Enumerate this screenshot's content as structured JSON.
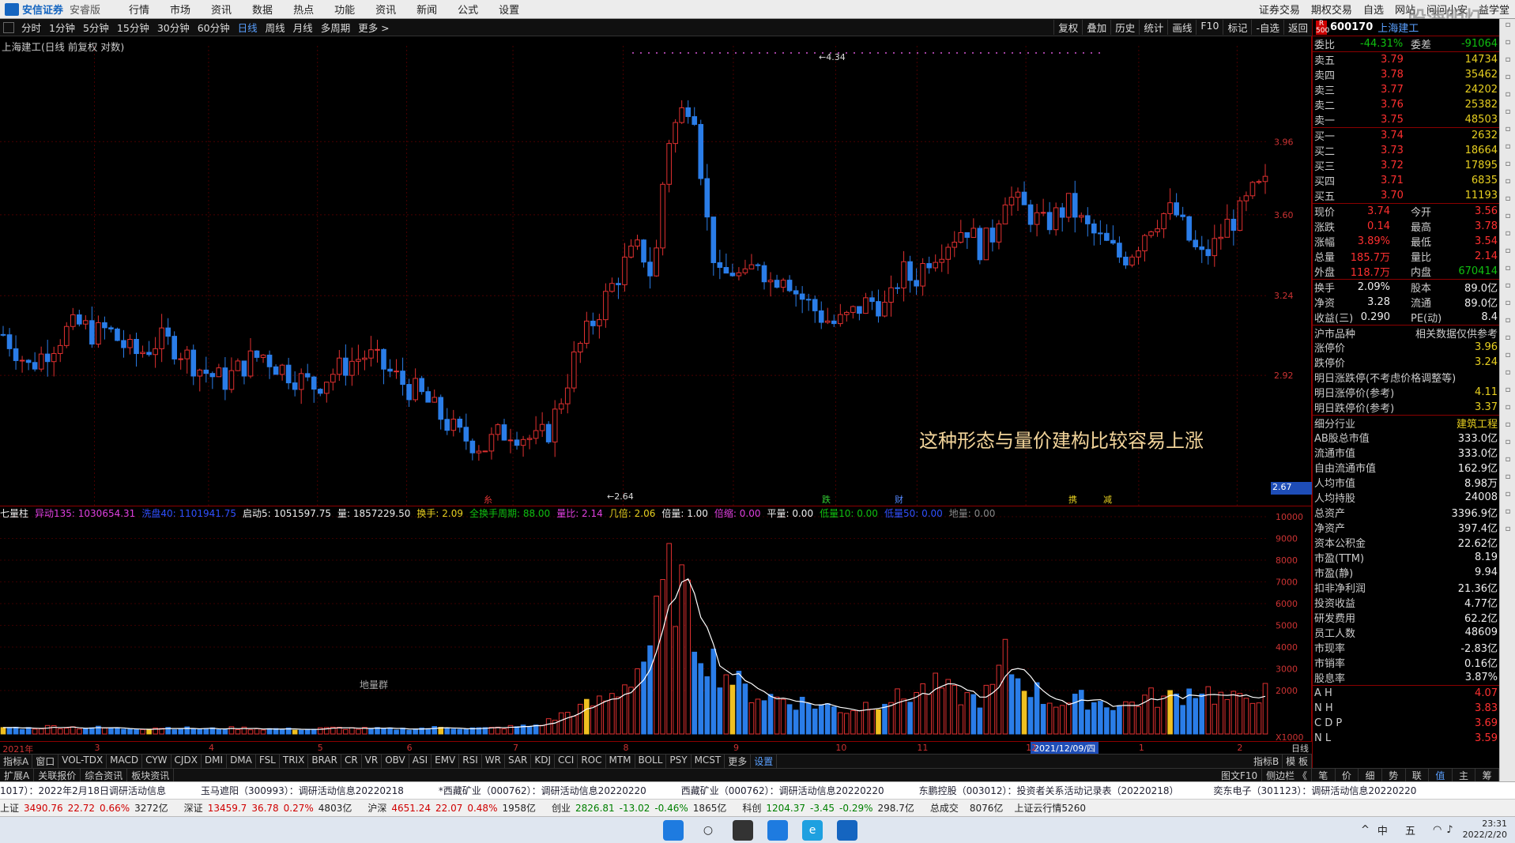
{
  "app": {
    "brand": "安信证券",
    "version": "安睿版",
    "watermark": "股海明灯"
  },
  "menu": [
    "行情",
    "市场",
    "资讯",
    "数据",
    "热点",
    "功能",
    "资讯",
    "新闻",
    "公式",
    "设置"
  ],
  "menu_right": [
    "证券交易",
    "期权交易",
    "自选",
    "网站",
    "问问小安",
    "益学堂"
  ],
  "periods": [
    "分时",
    "1分钟",
    "5分钟",
    "15分钟",
    "30分钟",
    "60分钟",
    "日线",
    "周线",
    "月线",
    "多周期",
    "更多 >"
  ],
  "active_period": "日线",
  "toolbar_right": [
    "复权",
    "叠加",
    "历史",
    "统计",
    "画线",
    "F10",
    "标记",
    "-自选",
    "返回"
  ],
  "chart_title": "上海建工(日线 前复权 对数)",
  "annotation": "这种形态与量价建构比较容易上涨",
  "price_labels": [
    "3.96",
    "3.60",
    "3.24",
    "2.92"
  ],
  "current_price_tag": "2.67",
  "high_label": "4.34",
  "low_label": "2.64",
  "event_marks": [
    "糸",
    "跌",
    "财",
    "携",
    "减"
  ],
  "vol_labels": [
    "10000",
    "9000",
    "8000",
    "7000",
    "6000",
    "5000",
    "4000",
    "3000",
    "2000",
    "X1000"
  ],
  "vol_note": "地量群",
  "vinfo": [
    {
      "t": "七量柱",
      "c": "#eee"
    },
    {
      "t": "异动135: 1030654.31",
      "c": "#e040e0"
    },
    {
      "t": "洗盘40: 1101941.75",
      "c": "#3050ff"
    },
    {
      "t": "启动5: 1051597.75",
      "c": "#eee"
    },
    {
      "t": "量: 1857229.50",
      "c": "#eee"
    },
    {
      "t": "换手: 2.09",
      "c": "#e8d020"
    },
    {
      "t": "全换手周期: 88.00",
      "c": "#10c010"
    },
    {
      "t": "量比: 2.14",
      "c": "#e040e0"
    },
    {
      "t": "几倍: 2.06",
      "c": "#e8d020"
    },
    {
      "t": "倍量: 1.00",
      "c": "#eee"
    },
    {
      "t": "倍缩: 0.00",
      "c": "#e040e0"
    },
    {
      "t": "平量: 0.00",
      "c": "#eee"
    },
    {
      "t": "低量10: 0.00",
      "c": "#10c010"
    },
    {
      "t": "低量50: 0.00",
      "c": "#3050ff"
    },
    {
      "t": "地量: 0.00",
      "c": "#888"
    }
  ],
  "xaxis": [
    {
      "t": "2021年",
      "p": 0.2
    },
    {
      "t": "3",
      "p": 7.2
    },
    {
      "t": "4",
      "p": 15.9
    },
    {
      "t": "5",
      "p": 24.2
    },
    {
      "t": "6",
      "p": 31.0
    },
    {
      "t": "7",
      "p": 39.1
    },
    {
      "t": "8",
      "p": 47.5
    },
    {
      "t": "9",
      "p": 55.9
    },
    {
      "t": "10",
      "p": 63.7
    },
    {
      "t": "11",
      "p": 69.9
    },
    {
      "t": "12",
      "p": 78.2
    },
    {
      "t": "1",
      "p": 86.8
    },
    {
      "t": "2",
      "p": 94.3
    }
  ],
  "xaxis_highlight": "2021/12/09/四",
  "xaxis_right": "日线",
  "ind_tabs": [
    "指标A",
    "窗口",
    "VOL-TDX",
    "MACD",
    "CYW",
    "CJDX",
    "DMI",
    "DMA",
    "FSL",
    "TRIX",
    "BRAR",
    "CR",
    "VR",
    "OBV",
    "ASI",
    "EMV",
    "RSI",
    "WR",
    "SAR",
    "KDJ",
    "CCI",
    "ROC",
    "MTM",
    "BOLL",
    "PSY",
    "MCST",
    "更多",
    "设置"
  ],
  "ind_tabs_right": [
    "指标B",
    "模 板"
  ],
  "bottom_tabs": [
    "扩展A",
    "关联报价",
    "综合资讯",
    "板块资讯"
  ],
  "bottom_right": [
    "图文F10",
    "侧边栏 《"
  ],
  "news": [
    "1017）：2022年2月18日调研活动信息",
    "玉马遮阳（300993）：调研活动信息20220218",
    "*西藏矿业（000762）：调研活动信息20220220",
    "西藏矿业（000762）：调研活动信息20220220",
    "东鹏控股（003012）：投资者关系活动记录表（20220218）",
    "奕东电子（301123）：调研活动信息20220220"
  ],
  "indices": [
    {
      "name": "上证",
      "v": "3490.76",
      "c": "22.72",
      "p": "0.66%",
      "a": "3272亿",
      "d": "up"
    },
    {
      "name": "深证",
      "v": "13459.7",
      "c": "36.78",
      "p": "0.27%",
      "a": "4803亿",
      "d": "up"
    },
    {
      "name": "沪深",
      "v": "4651.24",
      "c": "22.07",
      "p": "0.48%",
      "a": "1958亿",
      "d": "up"
    },
    {
      "name": "创业",
      "v": "2826.81",
      "c": "-13.02",
      "p": "-0.46%",
      "a": "1865亿",
      "d": "dn"
    },
    {
      "name": "科创",
      "v": "1204.37",
      "c": "-3.45",
      "p": "-0.29%",
      "a": "298.7亿",
      "d": "dn"
    }
  ],
  "total_label": "总成交",
  "total_value": "8076亿",
  "cloud": "上证云行情5260",
  "clock_time": "23:31",
  "clock_date": "2022/2/20",
  "tray_ime": "中",
  "tray_day": "五",
  "quote": {
    "tag": "R 500",
    "code": "600170",
    "name": "上海建工",
    "weibi_l": "委比",
    "weibi_v": "-44.31%",
    "weicha_l": "委差",
    "weicha_v": "-91064",
    "asks": [
      {
        "l": "卖五",
        "p": "3.79",
        "q": "14734"
      },
      {
        "l": "卖四",
        "p": "3.78",
        "q": "35462"
      },
      {
        "l": "卖三",
        "p": "3.77",
        "q": "24202"
      },
      {
        "l": "卖二",
        "p": "3.76",
        "q": "25382"
      },
      {
        "l": "卖一",
        "p": "3.75",
        "q": "48503"
      }
    ],
    "bids": [
      {
        "l": "买一",
        "p": "3.74",
        "q": "2632"
      },
      {
        "l": "买二",
        "p": "3.73",
        "q": "18664"
      },
      {
        "l": "买三",
        "p": "3.72",
        "q": "17895"
      },
      {
        "l": "买四",
        "p": "3.71",
        "q": "6835"
      },
      {
        "l": "买五",
        "p": "3.70",
        "q": "11193"
      }
    ],
    "stats": [
      {
        "l": "现价",
        "v": "3.74",
        "l2": "今开",
        "v2": "3.56"
      },
      {
        "l": "涨跌",
        "v": "0.14",
        "l2": "最高",
        "v2": "3.78"
      },
      {
        "l": "涨幅",
        "v": "3.89%",
        "l2": "最低",
        "v2": "3.54"
      },
      {
        "l": "总量",
        "v": "185.7万",
        "l2": "量比",
        "v2": "2.14"
      },
      {
        "l": "外盘",
        "v": "118.7万",
        "l2": "内盘",
        "v2": "670414"
      }
    ],
    "stats2": [
      {
        "l": "换手",
        "v": "2.09%",
        "l2": "股本",
        "v2": "89.0亿"
      },
      {
        "l": "净资",
        "v": "3.28",
        "l2": "流通",
        "v2": "89.0亿"
      },
      {
        "l": "收益(三)",
        "v": "0.290",
        "l2": "PE(动)",
        "v2": "8.4"
      }
    ],
    "sect_l": "沪市品种",
    "sect_r": "相关数据仅供参考",
    "limits": [
      {
        "l": "涨停价",
        "v": "3.96"
      },
      {
        "l": "跌停价",
        "v": "3.24"
      }
    ],
    "tomorrow": [
      {
        "l": "明日涨跌停(不考虑价格调整等)",
        "v": ""
      },
      {
        "l": "明日涨停价(参考)",
        "v": "4.11"
      },
      {
        "l": "明日跌停价(参考)",
        "v": "3.37"
      }
    ],
    "industry_l": "细分行业",
    "industry_v": "建筑工程",
    "fund": [
      {
        "l": "AB股总市值",
        "v": "333.0亿"
      },
      {
        "l": "流通市值",
        "v": "333.0亿"
      },
      {
        "l": "自由流通市值",
        "v": "162.9亿"
      },
      {
        "l": "人均市值",
        "v": "8.98万"
      },
      {
        "l": "人均持股",
        "v": "24008"
      },
      {
        "l": "总资产",
        "v": "3396.9亿"
      },
      {
        "l": "净资产",
        "v": "397.4亿"
      },
      {
        "l": "资本公积金",
        "v": "22.62亿"
      },
      {
        "l": "市盈(TTM)",
        "v": "8.19"
      },
      {
        "l": "市盈(静)",
        "v": "9.94"
      },
      {
        "l": "扣非净利润",
        "v": "21.36亿"
      },
      {
        "l": "投资收益",
        "v": "4.77亿"
      },
      {
        "l": "研发费用",
        "v": "62.2亿"
      },
      {
        "l": "员工人数",
        "v": "48609"
      },
      {
        "l": "市现率",
        "v": "-2.83亿"
      },
      {
        "l": "市销率",
        "v": "0.16亿"
      },
      {
        "l": "股息率",
        "v": "3.87%"
      }
    ],
    "related": [
      {
        "l": "A H",
        "v": "4.07"
      },
      {
        "l": "N H",
        "v": "3.83"
      },
      {
        "l": "C D P",
        "v": "3.69"
      },
      {
        "l": "N L",
        "v": "3.59"
      }
    ],
    "tabs": [
      "笔",
      "价",
      "细",
      "势",
      "联",
      "值",
      "主",
      "筹"
    ],
    "active_tab": "值"
  },
  "colors": {
    "up": "#e03030",
    "down": "#2a7de8",
    "ma": "#ffffff",
    "border": "#8b0000"
  },
  "chart_data": {
    "type": "candlestick",
    "symbol": "600170",
    "name": "上海建工",
    "period": "日线",
    "x_range": [
      "2021-02",
      "2022-02"
    ],
    "ylim": [
      2.64,
      4.34
    ],
    "close_path": [
      3.08,
      3.02,
      2.95,
      3.0,
      3.05,
      3.1,
      3.12,
      3.08,
      3.1,
      3.05,
      3.0,
      3.02,
      3.06,
      3.04,
      3.0,
      2.95,
      2.92,
      2.9,
      2.94,
      2.98,
      3.0,
      2.96,
      2.93,
      2.9,
      2.88,
      2.92,
      2.95,
      2.98,
      3.0,
      2.96,
      2.92,
      2.88,
      2.85,
      2.8,
      2.75,
      2.7,
      2.68,
      2.66,
      2.7,
      2.72,
      2.7,
      2.68,
      2.72,
      2.85,
      3.0,
      3.1,
      3.2,
      3.3,
      3.4,
      3.45,
      3.3,
      3.95,
      4.1,
      4.2,
      3.6,
      3.3,
      3.35,
      3.3,
      3.4,
      3.3,
      3.35,
      3.25,
      3.2,
      3.15,
      3.12,
      3.15,
      3.2,
      3.22,
      3.18,
      3.35,
      3.3,
      3.4,
      3.45,
      3.5,
      3.55,
      3.45,
      3.5,
      3.7,
      3.65,
      3.6,
      3.55,
      3.6,
      3.65,
      3.55,
      3.5,
      3.45,
      3.4,
      3.45,
      3.55,
      3.6,
      3.62,
      3.5,
      3.4,
      3.45,
      3.55,
      3.6,
      3.7,
      3.74
    ],
    "volume_x1000_path": [
      300,
      280,
      260,
      310,
      350,
      320,
      290,
      300,
      260,
      240,
      250,
      270,
      300,
      280,
      260,
      240,
      230,
      250,
      270,
      260,
      240,
      230,
      220,
      210,
      230,
      260,
      280,
      250,
      240,
      230,
      220,
      240,
      260,
      280,
      300,
      270,
      260,
      250,
      280,
      320,
      350,
      400,
      600,
      900,
      1100,
      1300,
      1500,
      1800,
      2500,
      3200,
      4500,
      7000,
      6800,
      4800,
      3800,
      3000,
      2600,
      2000,
      1800,
      1700,
      1600,
      1500,
      1400,
      1300,
      1200,
      1100,
      1300,
      1500,
      1700,
      1600,
      1900,
      2100,
      2200,
      1800,
      1700,
      1600,
      2000,
      3500,
      2500,
      2200,
      1600,
      1500,
      1400,
      1600,
      1500,
      1400,
      1300,
      1500,
      1700,
      1600,
      1700,
      1900,
      2200,
      1800,
      1600,
      1500,
      1900,
      1857
    ],
    "ylim_volume": [
      0,
      10000
    ]
  }
}
